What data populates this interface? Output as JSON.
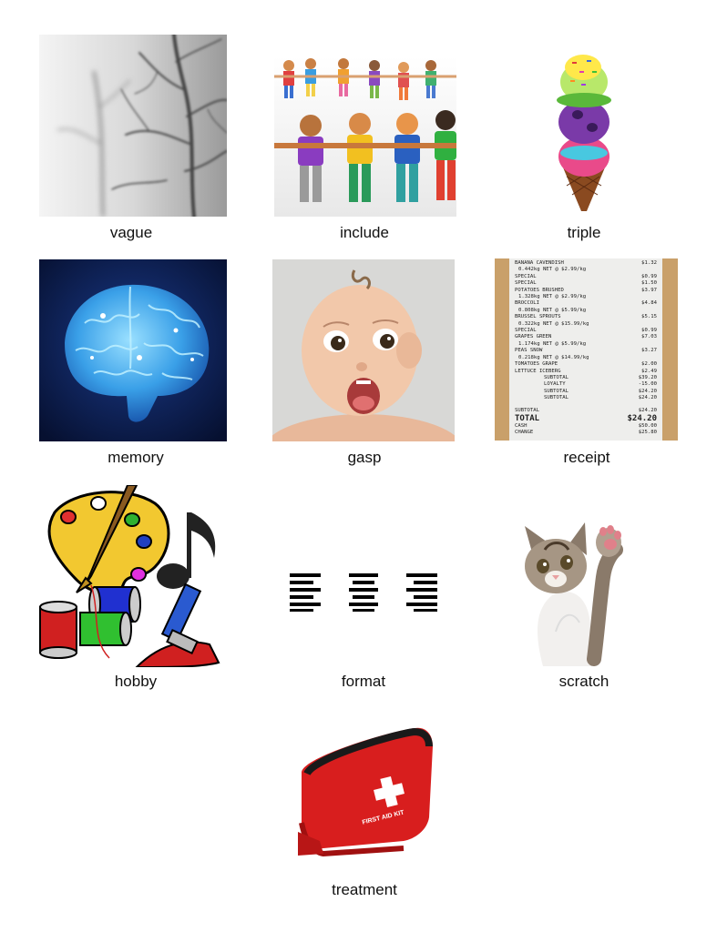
{
  "items": [
    {
      "word": "vague",
      "image": "vague-tree-image"
    },
    {
      "word": "include",
      "image": "paper-people-chain-image"
    },
    {
      "word": "triple",
      "image": "triple-ice-cream-cone-image"
    },
    {
      "word": "memory",
      "image": "glowing-brain-image"
    },
    {
      "word": "gasp",
      "image": "surprised-baby-image"
    },
    {
      "word": "receipt",
      "image": "grocery-receipt-image"
    },
    {
      "word": "hobby",
      "image": "art-music-sewing-clipart-image"
    },
    {
      "word": "format",
      "image": "text-alignment-icons-image"
    },
    {
      "word": "scratch",
      "image": "kitten-raised-paw-image"
    },
    {
      "word": "treatment",
      "image": "first-aid-kit-image"
    }
  ],
  "receipt": {
    "lines": [
      [
        "BANANA CAVENDISH",
        "$1.32"
      ],
      [
        "0.442kg NET @ $2.99/kg",
        ""
      ],
      [
        "SPECIAL",
        "$0.99"
      ],
      [
        "SPECIAL",
        "$1.50"
      ],
      [
        "POTATOES BRUSHED",
        "$3.97"
      ],
      [
        "1.328kg NET @ $2.99/kg",
        ""
      ],
      [
        "BROCCOLI",
        "$4.84"
      ],
      [
        "0.808kg NET @ $5.99/kg",
        ""
      ],
      [
        "BRUSSEL SPROUTS",
        "$5.15"
      ],
      [
        "0.322kg NET @ $15.99/kg",
        ""
      ],
      [
        "SPECIAL",
        "$0.99"
      ],
      [
        "GRAPES GREEN",
        "$7.03"
      ],
      [
        "1.174kg NET @ $5.99/kg",
        ""
      ],
      [
        "PEAS SNOW",
        "$3.27"
      ],
      [
        "0.218kg NET @ $14.99/kg",
        ""
      ],
      [
        "TOMATOES GRAPE",
        "$2.00"
      ],
      [
        "LETTUCE ICEBERG",
        "$2.49"
      ],
      [
        "SUBTOTAL",
        "$39.20"
      ],
      [
        "LOYALTY",
        "-15.00"
      ],
      [
        "SUBTOTAL",
        "$24.20"
      ],
      [
        "SUBTOTAL",
        "$24.20"
      ]
    ],
    "subtotal_label": "SUBTOTAL",
    "subtotal_value": "$24.20",
    "total_label": "TOTAL",
    "total_value": "$24.20",
    "cash_label": "CASH",
    "cash_value": "$50.00",
    "change_label": "CHANGE",
    "change_value": "$25.80"
  },
  "kit": {
    "label": "FIRST AID KIT"
  }
}
